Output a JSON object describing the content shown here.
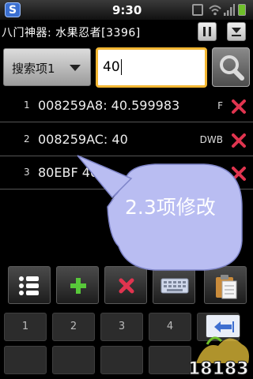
{
  "status": {
    "time": "9:30",
    "app_badge": "S"
  },
  "title_bar": {
    "title": "八门神器: 水果忍者[3396]"
  },
  "search": {
    "type_label": "搜索项1",
    "value": "40"
  },
  "results": [
    {
      "index": "1",
      "value": "008259A8: 40.599983",
      "type": "F"
    },
    {
      "index": "2",
      "value": "008259AC: 40",
      "type": "DWB"
    },
    {
      "index": "3",
      "value": "80EBF   40",
      "type": "DWB"
    }
  ],
  "annotation": {
    "text": "2.3项修改"
  },
  "keypad": {
    "keys": [
      "1",
      "2",
      "3",
      "4",
      "5"
    ]
  },
  "colors": {
    "accent": "#f3b733",
    "delete": "#e0344f",
    "bubble": "#b9bdf2",
    "add": "#58c83a"
  },
  "icons": {
    "app": "s-badge-icon",
    "search": "magnifier-icon",
    "delete": "x-icon",
    "list": "list-icon",
    "add": "plus-icon",
    "remove": "x-icon",
    "keyboard": "keyboard-icon",
    "clipboard": "clipboard-icon",
    "backspace": "backspace-icon"
  }
}
